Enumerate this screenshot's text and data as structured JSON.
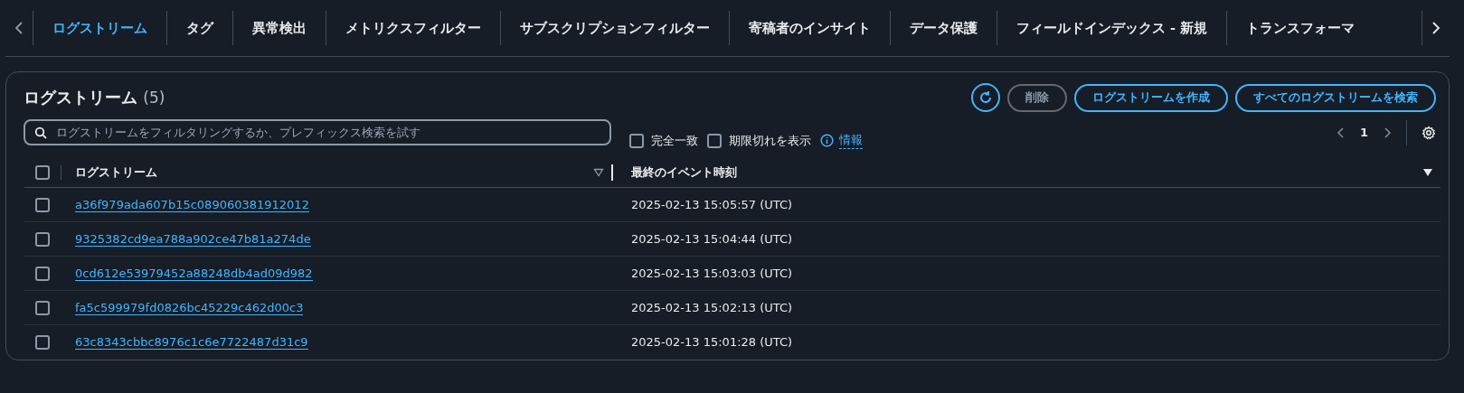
{
  "tabs": [
    {
      "label": "ログストリーム",
      "selected": true
    },
    {
      "label": "タグ",
      "selected": false
    },
    {
      "label": "異常検出",
      "selected": false
    },
    {
      "label": "メトリクスフィルター",
      "selected": false
    },
    {
      "label": "サブスクリプションフィルター",
      "selected": false
    },
    {
      "label": "寄稿者のインサイト",
      "selected": false
    },
    {
      "label": "データ保護",
      "selected": false
    },
    {
      "label": "フィールドインデックス - 新規",
      "selected": false
    },
    {
      "label": "トランスフォーマ",
      "selected": false
    }
  ],
  "panel": {
    "title": "ログストリーム",
    "count": "(5)",
    "actions": [
      {
        "kind": "refresh",
        "disabled": false
      },
      {
        "kind": "text",
        "label": "削除",
        "disabled": true
      },
      {
        "kind": "text",
        "label": "ログストリームを作成",
        "disabled": false
      },
      {
        "kind": "text",
        "label": "すべてのログストリームを検索",
        "disabled": false
      }
    ],
    "search": {
      "placeholder": "ログストリームをフィルタリングするか、プレフィックス検索を試す"
    },
    "options": [
      {
        "label": "完全一致",
        "checked": false
      },
      {
        "label": "期限切れを表示",
        "checked": false
      }
    ],
    "info_link": "情報",
    "page": "1",
    "table": {
      "select_all": {
        "checked": false
      },
      "columns": [
        {
          "label": "ログストリーム",
          "sorted": false
        },
        {
          "label": "最終のイベント時刻",
          "sorted": true
        }
      ],
      "rows": [
        {
          "checked": false,
          "name": "a36f979ada607b15c089060381912012",
          "time": "2025-02-13 15:05:57 (UTC)"
        },
        {
          "checked": false,
          "name": "9325382cd9ea788a902ce47b81a274de",
          "time": "2025-02-13 15:04:44 (UTC)"
        },
        {
          "checked": false,
          "name": "0cd612e53979452a88248db4ad09d982",
          "time": "2025-02-13 15:03:03 (UTC)"
        },
        {
          "checked": false,
          "name": "fa5c599979fd0826bc45229c462d00c3",
          "time": "2025-02-13 15:02:13 (UTC)"
        },
        {
          "checked": false,
          "name": "63c8343cbbc8976c1c6e7722487d31c9",
          "time": "2025-02-13 15:01:28 (UTC)"
        }
      ]
    }
  }
}
